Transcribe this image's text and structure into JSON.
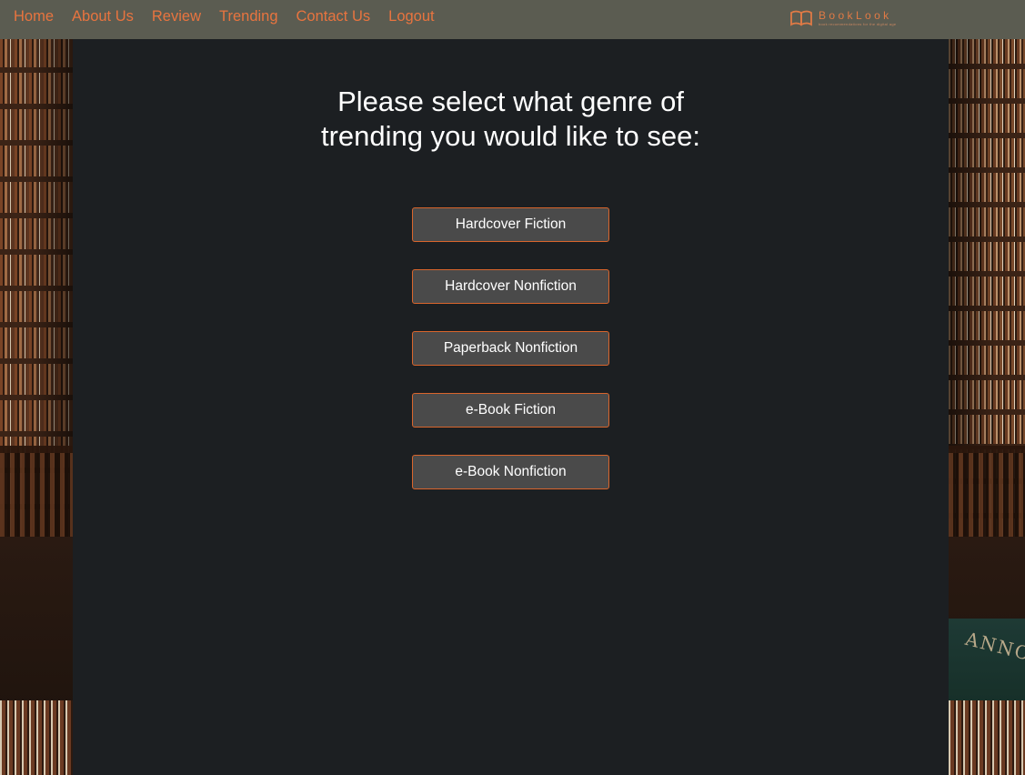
{
  "nav": {
    "links": [
      {
        "label": "Home"
      },
      {
        "label": "About Us"
      },
      {
        "label": "Review"
      },
      {
        "label": "Trending"
      },
      {
        "label": "Contact Us"
      },
      {
        "label": "Logout"
      }
    ],
    "link_color": "#e8743f",
    "background": "#5b5c51"
  },
  "logo": {
    "name": "BookLook",
    "tagline": "book recommendations for the digital age",
    "icon": "open-book-icon"
  },
  "main": {
    "heading": "Please select what genre of trending you would like to see:",
    "genres": [
      {
        "label": "Hardcover Fiction"
      },
      {
        "label": "Hardcover Nonfiction"
      },
      {
        "label": "Paperback Nonfiction"
      },
      {
        "label": "e-Book Fiction"
      },
      {
        "label": "e-Book Nonfiction"
      }
    ],
    "panel_color": "#1c1f22",
    "button_color": "#4a4a4a",
    "button_border": "#d9652c"
  },
  "background": {
    "inscription": "ANNO"
  }
}
